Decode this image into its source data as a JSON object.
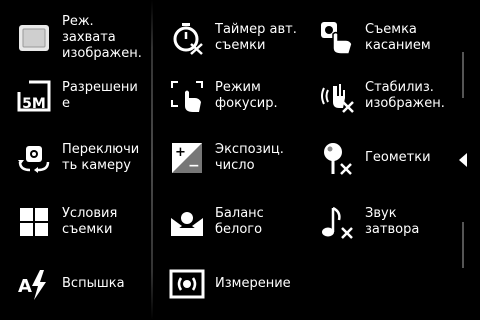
{
  "menu": {
    "col1": [
      {
        "name": "capture-mode",
        "icon": "capture-mode-icon",
        "label": "Реж.\nзахвата\nизображен."
      },
      {
        "name": "resolution",
        "icon": "resolution-5m-icon",
        "label": "Разрешени\nе"
      },
      {
        "name": "switch-camera",
        "icon": "switch-camera-icon",
        "label": "Переключи\nть камеру"
      },
      {
        "name": "scene-mode",
        "icon": "scene-grid-icon",
        "label": "Условия\nсъемки"
      },
      {
        "name": "flash",
        "icon": "flash-auto-icon",
        "label": "Вспышка"
      }
    ],
    "col2": [
      {
        "name": "self-timer",
        "icon": "timer-off-icon",
        "label": "Таймер авт.\nсъемки"
      },
      {
        "name": "focus-mode",
        "icon": "focus-touch-icon",
        "label": "Режим\nфокусир."
      },
      {
        "name": "exposure",
        "icon": "exposure-icon",
        "label": "Экспозиц.\nчисло"
      },
      {
        "name": "white-balance",
        "icon": "white-balance-icon",
        "label": "Баланс\nбелого"
      },
      {
        "name": "metering",
        "icon": "metering-icon",
        "label": "Измерение"
      }
    ],
    "col3": [
      {
        "name": "touch-shot",
        "icon": "touch-shot-icon",
        "label": "Съемка\nкасанием"
      },
      {
        "name": "stabilization",
        "icon": "stabilization-off-icon",
        "label": "Стабилиз.\nизображен."
      },
      {
        "name": "geotag",
        "icon": "geotag-off-icon",
        "label": "Геометки"
      },
      {
        "name": "shutter-sound",
        "icon": "shutter-sound-off-icon",
        "label": "Звук\nзатвора"
      }
    ]
  },
  "panel": {
    "collapse_icon": "arrow-left-icon"
  }
}
